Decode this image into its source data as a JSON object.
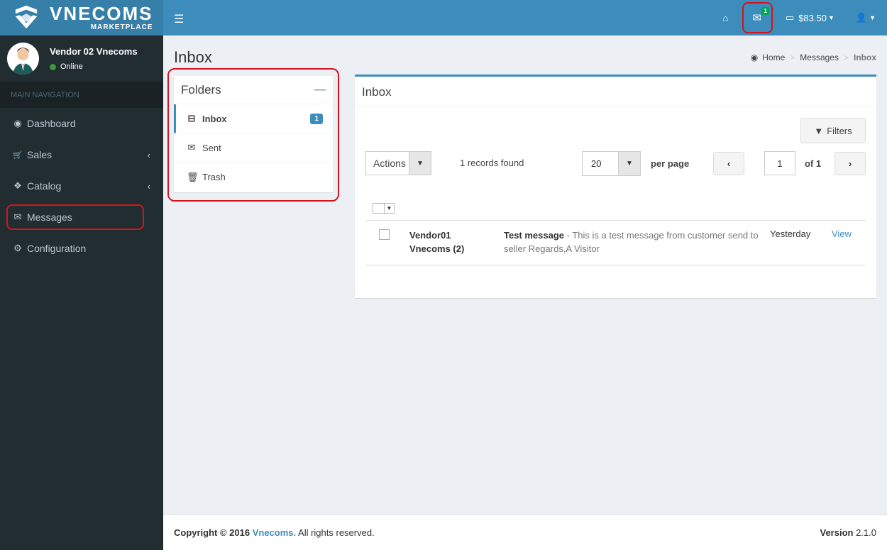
{
  "brand": {
    "name": "VNECOMS",
    "sub": "MARKETPLACE"
  },
  "user": {
    "name": "Vendor 02 Vnecoms",
    "status": "Online"
  },
  "sidebar": {
    "header": "MAIN NAVIGATION",
    "items": [
      {
        "label": "Dashboard",
        "icon": "dashboard-icon",
        "glyph": "◉"
      },
      {
        "label": "Sales",
        "icon": "cart-icon",
        "glyph": "🛒",
        "chevron": "‹"
      },
      {
        "label": "Catalog",
        "icon": "cubes-icon",
        "glyph": "❖",
        "chevron": "‹"
      },
      {
        "label": "Messages",
        "icon": "envelope-icon",
        "glyph": "✉"
      },
      {
        "label": "Configuration",
        "icon": "gear-icon",
        "glyph": "⚙"
      }
    ]
  },
  "topbar": {
    "mail_badge": "1",
    "balance": "$83.50"
  },
  "page": {
    "title": "Inbox"
  },
  "breadcrumb": {
    "home": "Home",
    "messages": "Messages",
    "current": "Inbox"
  },
  "folders": {
    "title": "Folders",
    "items": [
      {
        "label": "Inbox",
        "badge": "1"
      },
      {
        "label": "Sent"
      },
      {
        "label": "Trash"
      }
    ]
  },
  "inbox": {
    "title": "Inbox",
    "filters_label": "Filters",
    "actions_label": "Actions",
    "records": "1 records found",
    "per_page_value": "20",
    "per_page_label": "per page",
    "page_value": "1",
    "of_pages": "of 1",
    "rows": [
      {
        "from_line1": "Vendor01",
        "from_line2": "Vnecoms (2)",
        "subject": "Test message",
        "preview": " - This is a test message from customer send to seller Regards,A Visitor",
        "date": "Yesterday",
        "action": "View"
      }
    ]
  },
  "footer": {
    "copyright": "Copyright © 2016 ",
    "company": "Vnecoms.",
    "rights": " All rights reserved.",
    "version_label": "Version",
    "version": " 2.1.0"
  }
}
